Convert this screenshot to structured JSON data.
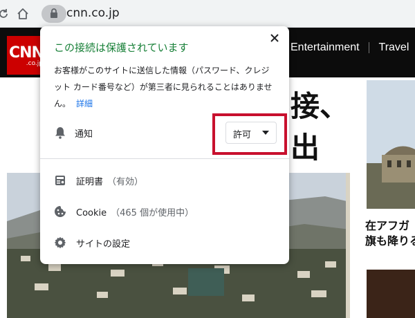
{
  "browser": {
    "url": "cnn.co.jp"
  },
  "site": {
    "logo": "CNN",
    "logo_sub": ".co.jp",
    "nav": [
      "Entertainment",
      "Travel"
    ],
    "headline_fragment": [
      "接、",
      "出"
    ],
    "side_caption": [
      "在アフガ",
      "旗も降りる"
    ]
  },
  "popup": {
    "title": "この接続は保護されています",
    "description": "お客様がこのサイトに送信した情報（パスワード、クレジット カード番号など）が第三者に見られることはありません。",
    "details_link": "詳細",
    "notifications": {
      "label": "通知",
      "value": "許可"
    },
    "certificate": {
      "label": "証明書",
      "status": "（有効）"
    },
    "cookies": {
      "label": "Cookie",
      "status": "（465 個が使用中）"
    },
    "site_settings": {
      "label": "サイトの設定"
    }
  },
  "colors": {
    "secure_green": "#188038",
    "link_blue": "#1a73e8",
    "highlight_red": "#c8102e",
    "cnn_red": "#cc0000"
  }
}
